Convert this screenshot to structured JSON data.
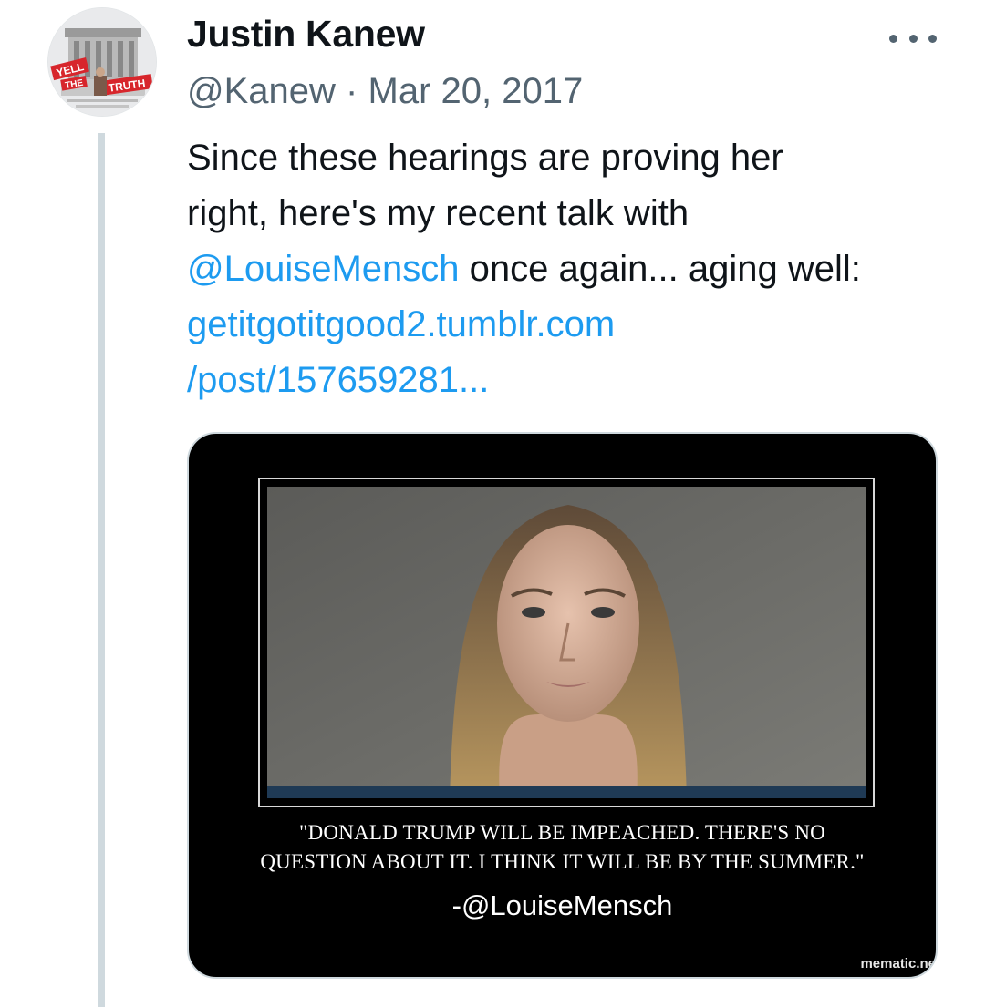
{
  "tweet": {
    "author": {
      "display_name": "Justin Kanew",
      "avatar_sign": [
        "YELL",
        "THE",
        "TRUTH"
      ]
    },
    "handle": "@Kanew",
    "separator": "·",
    "date": "Mar 20, 2017",
    "more_icon": "more-horizontal-icon",
    "text": {
      "line1": "Since these hearings are proving her",
      "line2": "right, here's my recent talk with",
      "mention": "@LouiseMensch",
      "line3_rest": " once again... aging well:",
      "link_part1": "getitgotitgood2.tumblr.com",
      "link_part2": "/post/157659281..."
    },
    "media": {
      "quote_line1": "\"DONALD TRUMP WILL BE IMPEACHED. THERE'S NO",
      "quote_line2": "QUESTION ABOUT IT. I THINK IT WILL BE BY THE SUMMER.\"",
      "attribution": "-@LouiseMensch",
      "watermark": "mematic.ne"
    }
  },
  "colors": {
    "link": "#1d9bf0",
    "secondary_text": "#536471",
    "primary_text": "#0f1419",
    "thread_line": "#cfd9de",
    "media_background": "#000000"
  }
}
